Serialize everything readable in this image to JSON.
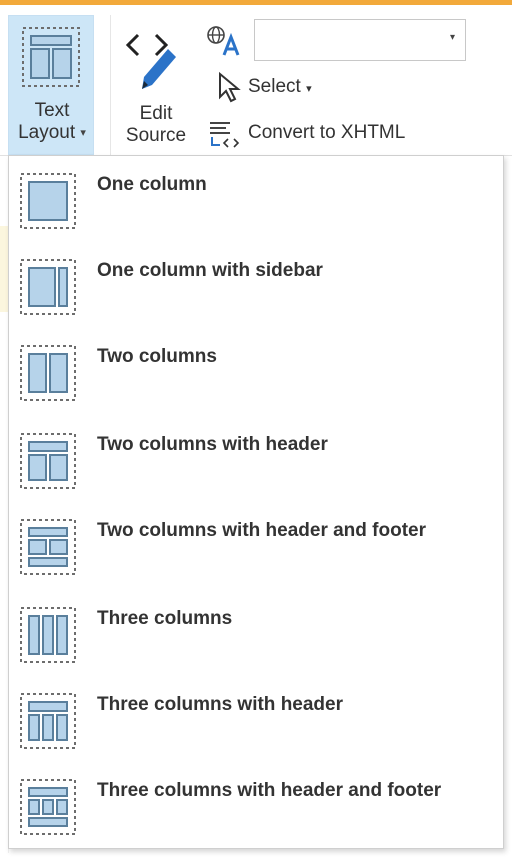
{
  "ribbon": {
    "text_layout": {
      "label_line1": "Text",
      "label_line2": "Layout",
      "caret": "▾"
    },
    "edit_source": {
      "label_line1": "Edit",
      "label_line2": "Source"
    },
    "language_select": {
      "value": "",
      "arrow": "▾"
    },
    "select": {
      "label": "Select",
      "caret": "▾"
    },
    "convert": {
      "label": "Convert to XHTML"
    }
  },
  "layout_menu": {
    "items": [
      {
        "label": "One column",
        "icon": "one-column-icon"
      },
      {
        "label": "One column with sidebar",
        "icon": "one-column-sidebar-icon"
      },
      {
        "label": "Two columns",
        "icon": "two-columns-icon"
      },
      {
        "label": "Two columns with header",
        "icon": "two-columns-header-icon"
      },
      {
        "label": "Two columns with header and footer",
        "icon": "two-columns-header-footer-icon"
      },
      {
        "label": "Three columns",
        "icon": "three-columns-icon"
      },
      {
        "label": "Three columns with header",
        "icon": "three-columns-header-icon"
      },
      {
        "label": "Three columns with header and footer",
        "icon": "three-columns-header-footer-icon"
      }
    ]
  },
  "colors": {
    "accent_top": "#f2a93b",
    "selected_button_bg": "#cde6f7",
    "icon_fill": "#b6d3ea",
    "icon_stroke": "#5a7f9c"
  }
}
